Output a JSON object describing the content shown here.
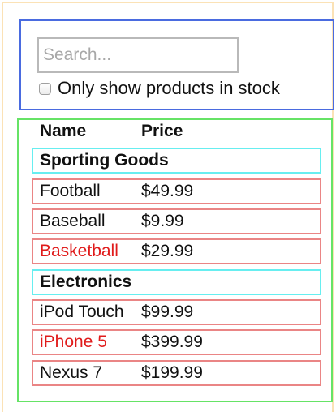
{
  "search": {
    "placeholder": "Search...",
    "checkbox_label": "Only show products in stock"
  },
  "table": {
    "headers": {
      "name": "Name",
      "price": "Price"
    },
    "rows": [
      {
        "kind": "category",
        "name": "Sporting Goods"
      },
      {
        "kind": "product",
        "name": "Football",
        "price": "$49.99",
        "in_stock": true
      },
      {
        "kind": "product",
        "name": "Baseball",
        "price": "$9.99",
        "in_stock": true
      },
      {
        "kind": "product",
        "name": "Basketball",
        "price": "$29.99",
        "in_stock": false
      },
      {
        "kind": "category",
        "name": "Electronics"
      },
      {
        "kind": "product",
        "name": "iPod Touch",
        "price": "$99.99",
        "in_stock": true
      },
      {
        "kind": "product",
        "name": "iPhone 5",
        "price": "$399.99",
        "in_stock": false
      },
      {
        "kind": "product",
        "name": "Nexus 7",
        "price": "$199.99",
        "in_stock": true
      }
    ]
  },
  "colors": {
    "outer_container": "#fbe2b6",
    "search_container": "#4a6be0",
    "table_container": "#66e366",
    "category_row": "#67eef0",
    "product_row": "#ea8585",
    "out_of_stock_text": "#e01b1b"
  }
}
